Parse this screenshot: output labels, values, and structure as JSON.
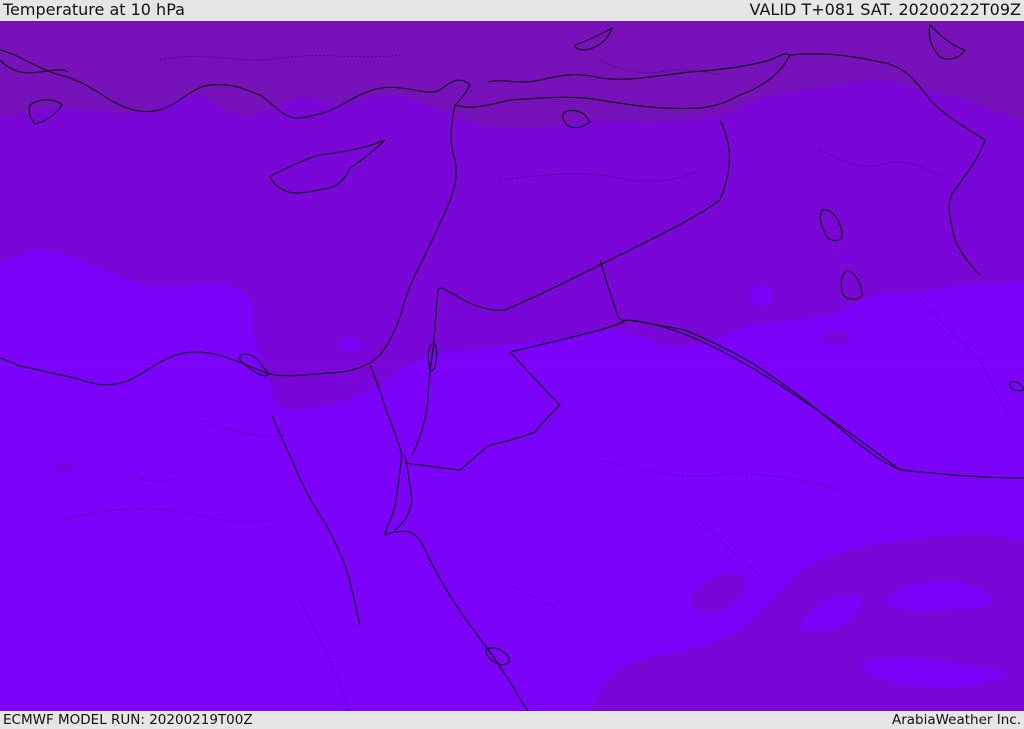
{
  "header": {
    "title": "Temperature at 10 hPa",
    "valid": "VALID T+081 SAT. 20200222T09Z"
  },
  "footer": {
    "model_run": "ECMWF MODEL RUN: 20200219T00Z",
    "credit": "ArabiaWeather Inc."
  },
  "colors": {
    "band_cold": "#7711b9",
    "band_mid": "#7a06d8",
    "band_warm": "#7c02fa",
    "border_line": "#000000",
    "background_bar": "#e6e6e6"
  }
}
